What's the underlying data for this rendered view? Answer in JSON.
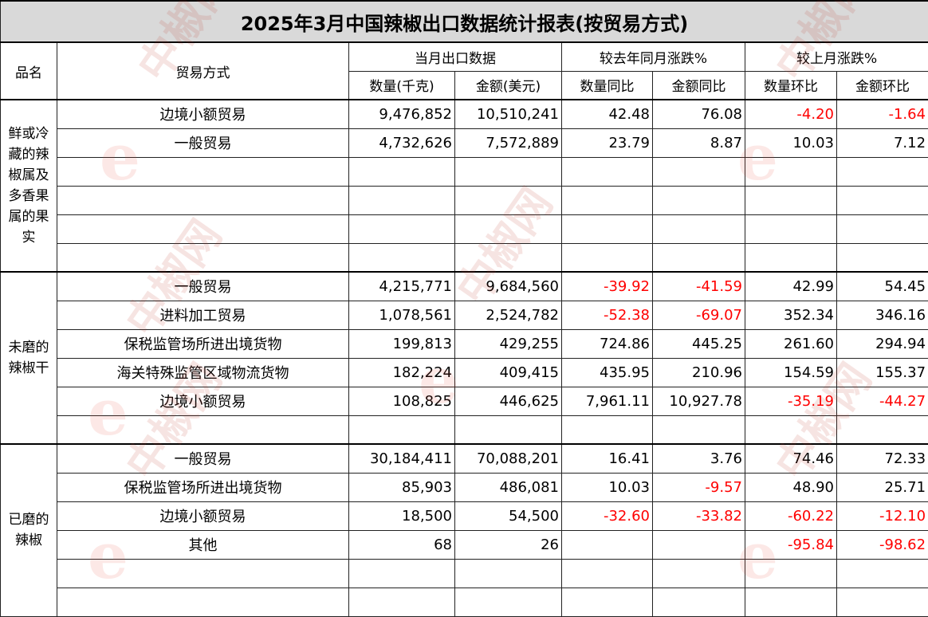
{
  "title": "2025年3月中国辣椒出口数据统计报表(按贸易方式)",
  "headers": {
    "product": "品名",
    "mode": "贸易方式",
    "current_month": "当月出口数据",
    "yoy": "较去年同月涨跌%",
    "mom": "较上月涨跌%",
    "qty": "数量(千克)",
    "amount": "金额(美元)",
    "qty_yoy": "数量同比",
    "amount_yoy": "金额同比",
    "qty_mom": "数量环比",
    "amount_mom": "金额环比"
  },
  "groups": [
    {
      "product": "鲜或冷藏的辣椒属及多香果属的果实",
      "rows": [
        {
          "mode": "边境小额贸易",
          "qty": "9,476,852",
          "amount": "10,510,241",
          "qty_yoy": "42.48",
          "amount_yoy": "76.08",
          "qty_mom": "-4.20",
          "amount_mom": "-1.64"
        },
        {
          "mode": "一般贸易",
          "qty": "4,732,626",
          "amount": "7,572,889",
          "qty_yoy": "23.79",
          "amount_yoy": "8.87",
          "qty_mom": "10.03",
          "amount_mom": "7.12"
        },
        {
          "mode": "",
          "qty": "",
          "amount": "",
          "qty_yoy": "",
          "amount_yoy": "",
          "qty_mom": "",
          "amount_mom": ""
        },
        {
          "mode": "",
          "qty": "",
          "amount": "",
          "qty_yoy": "",
          "amount_yoy": "",
          "qty_mom": "",
          "amount_mom": ""
        },
        {
          "mode": "",
          "qty": "",
          "amount": "",
          "qty_yoy": "",
          "amount_yoy": "",
          "qty_mom": "",
          "amount_mom": ""
        },
        {
          "mode": "",
          "qty": "",
          "amount": "",
          "qty_yoy": "",
          "amount_yoy": "",
          "qty_mom": "",
          "amount_mom": ""
        }
      ]
    },
    {
      "product": "未磨的辣椒干",
      "rows": [
        {
          "mode": "一般贸易",
          "qty": "4,215,771",
          "amount": "9,684,560",
          "qty_yoy": "-39.92",
          "amount_yoy": "-41.59",
          "qty_mom": "42.99",
          "amount_mom": "54.45"
        },
        {
          "mode": "进料加工贸易",
          "qty": "1,078,561",
          "amount": "2,524,782",
          "qty_yoy": "-52.38",
          "amount_yoy": "-69.07",
          "qty_mom": "352.34",
          "amount_mom": "346.16"
        },
        {
          "mode": "保税监管场所进出境货物",
          "qty": "199,813",
          "amount": "429,255",
          "qty_yoy": "724.86",
          "amount_yoy": "445.25",
          "qty_mom": "261.60",
          "amount_mom": "294.94"
        },
        {
          "mode": "海关特殊监管区域物流货物",
          "qty": "182,224",
          "amount": "409,415",
          "qty_yoy": "435.95",
          "amount_yoy": "210.96",
          "qty_mom": "154.59",
          "amount_mom": "155.37"
        },
        {
          "mode": "边境小额贸易",
          "qty": "108,825",
          "amount": "446,625",
          "qty_yoy": "7,961.11",
          "amount_yoy": "10,927.78",
          "qty_mom": "-35.19",
          "amount_mom": "-44.27"
        },
        {
          "mode": "",
          "qty": "",
          "amount": "",
          "qty_yoy": "",
          "amount_yoy": "",
          "qty_mom": "",
          "amount_mom": ""
        }
      ]
    },
    {
      "product": "已磨的辣椒",
      "rows": [
        {
          "mode": "一般贸易",
          "qty": "30,184,411",
          "amount": "70,088,201",
          "qty_yoy": "16.41",
          "amount_yoy": "3.76",
          "qty_mom": "74.46",
          "amount_mom": "72.33"
        },
        {
          "mode": "保税监管场所进出境货物",
          "qty": "85,903",
          "amount": "486,081",
          "qty_yoy": "10.03",
          "amount_yoy": "-9.57",
          "qty_mom": "48.90",
          "amount_mom": "25.71"
        },
        {
          "mode": "边境小额贸易",
          "qty": "18,500",
          "amount": "54,500",
          "qty_yoy": "-32.60",
          "amount_yoy": "-33.82",
          "qty_mom": "-60.22",
          "amount_mom": "-12.10"
        },
        {
          "mode": "其他",
          "qty": "68",
          "amount": "26",
          "qty_yoy": "",
          "amount_yoy": "",
          "qty_mom": "-95.84",
          "amount_mom": "-98.62"
        },
        {
          "mode": "",
          "qty": "",
          "amount": "",
          "qty_yoy": "",
          "amount_yoy": "",
          "qty_mom": "",
          "amount_mom": ""
        },
        {
          "mode": "",
          "qty": "",
          "amount": "",
          "qty_yoy": "",
          "amount_yoy": "",
          "qty_mom": "",
          "amount_mom": ""
        }
      ]
    }
  ],
  "watermark": {
    "brand": "中椒网",
    "glyph": "e"
  },
  "colors": {
    "negative": "#ff0000",
    "title_bg": "#d9d9d9"
  }
}
